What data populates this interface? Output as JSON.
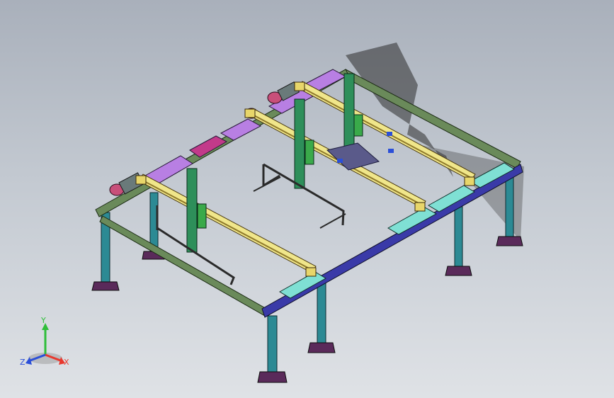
{
  "viewport": {
    "background_top": "#a9b0bb",
    "background_bottom": "#dfe2e6"
  },
  "triad": {
    "x_label": "X",
    "y_label": "Y",
    "z_label": "Z",
    "x_color": "#e8382e",
    "y_color": "#2fbe3a",
    "z_color": "#2b4fd8"
  },
  "model": {
    "frame_color": "#6a8a5a",
    "leg_color": "#2c8a94",
    "leg_foot_color": "#5a2a5a",
    "rail_color": "#f0e68a",
    "rail_dark": "#8f7a2a",
    "column_color": "#2e8f5a",
    "cover_color": "#b87fe3",
    "cover_alt_color": "#7fe0d4",
    "beam_front_color": "#3a3aa8",
    "motor_color": "#c84f7a",
    "tool_color": "#2a2a2a"
  }
}
